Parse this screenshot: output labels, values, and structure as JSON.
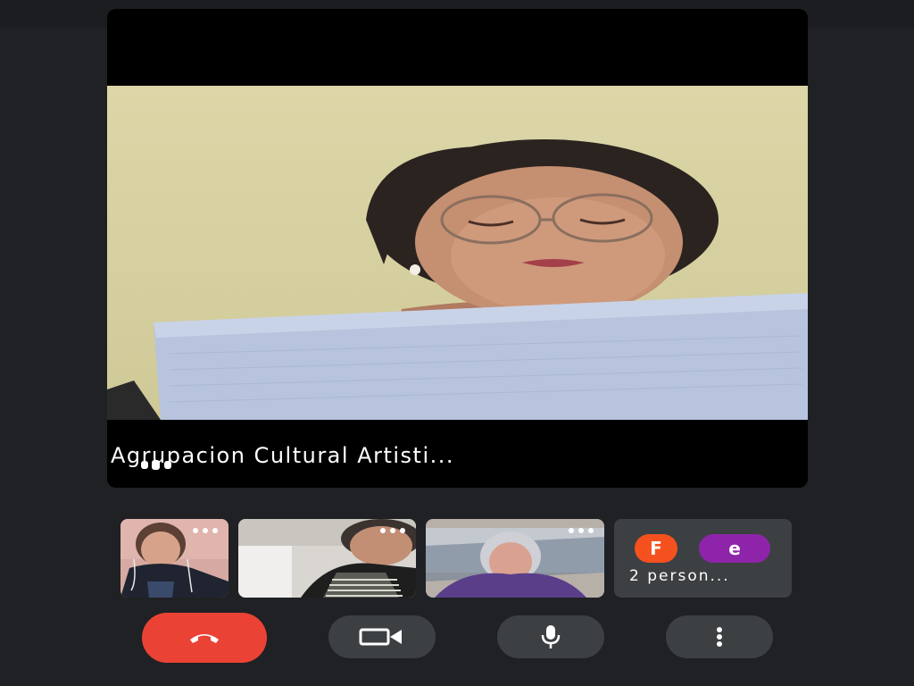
{
  "main_speaker": {
    "name": "Agrupacion Cultural Artisti...",
    "speaking_indicator": "audio-level-icon"
  },
  "thumbnails": [
    {
      "id": "participant-1",
      "menu_icon": "more-dots-icon"
    },
    {
      "id": "participant-2",
      "menu_icon": "more-dots-icon"
    },
    {
      "id": "participant-3",
      "menu_icon": "more-dots-icon"
    }
  ],
  "more_participants": {
    "avatars": [
      {
        "letter": "F",
        "color": "#f4511e"
      },
      {
        "letter": "e",
        "color": "#8e24aa"
      }
    ],
    "label": "2 person..."
  },
  "controls": {
    "end_call": {
      "icon": "phone-hangup-icon",
      "color": "#ea4335"
    },
    "camera": {
      "icon": "video-camera-icon"
    },
    "microphone": {
      "icon": "microphone-icon"
    },
    "more_options": {
      "icon": "more-vertical-icon"
    }
  },
  "colors": {
    "background": "#202124",
    "tile": "#3c4043",
    "end_call": "#ea4335"
  }
}
